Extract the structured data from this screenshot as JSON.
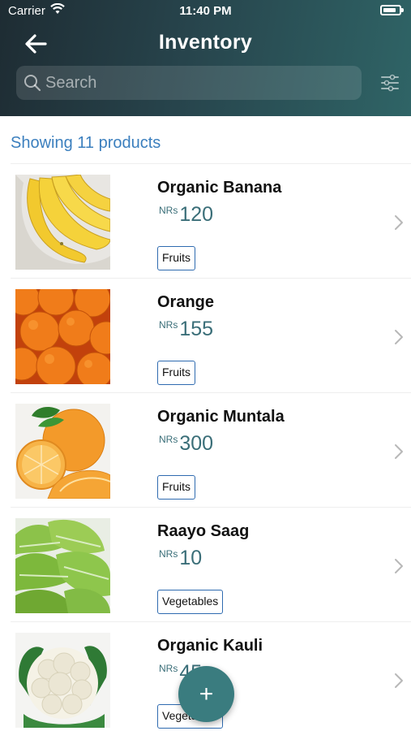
{
  "status_bar": {
    "carrier": "Carrier",
    "time": "11:40 PM"
  },
  "header": {
    "title": "Inventory"
  },
  "search": {
    "placeholder": "Search",
    "value": ""
  },
  "summary": "Showing 11 products",
  "products": [
    {
      "name": "Organic Banana",
      "currency": "NRs",
      "price": "120",
      "category": "Fruits",
      "image": "banana"
    },
    {
      "name": "Orange",
      "currency": "NRs",
      "price": "155",
      "category": "Fruits",
      "image": "orange"
    },
    {
      "name": "Organic Muntala",
      "currency": "NRs",
      "price": "300",
      "category": "Fruits",
      "image": "muntala"
    },
    {
      "name": "Raayo Saag",
      "currency": "NRs",
      "price": "10",
      "category": "Vegetables",
      "image": "greens"
    },
    {
      "name": "Organic Kauli",
      "currency": "NRs",
      "price": "45",
      "category": "Vegetables",
      "image": "cauliflower"
    }
  ],
  "fab": {
    "label": "+"
  },
  "colors": {
    "header_start": "#1e2c33",
    "header_end": "#2f6466",
    "accent": "#3a7c7f",
    "link": "#3b7fbe",
    "price": "#3a6e78"
  }
}
